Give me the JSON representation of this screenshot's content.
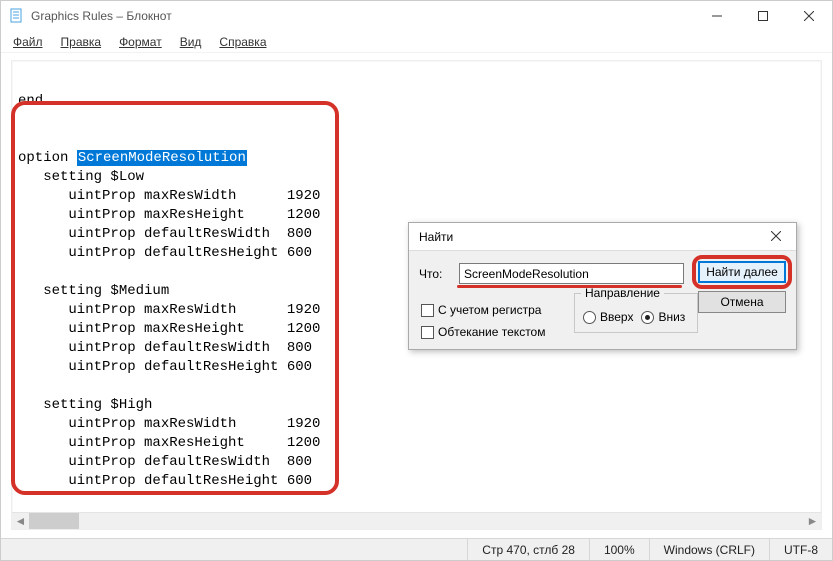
{
  "window": {
    "title": "Graphics Rules – Блокнот"
  },
  "menu": {
    "file": "Файл",
    "edit": "Правка",
    "format": "Формат",
    "view": "Вид",
    "help": "Справка"
  },
  "editor": {
    "l1": "end",
    "l2": "option ",
    "l2sel": "ScreenModeResolution",
    "l3": "   setting $Low",
    "l4": "      uintProp maxResWidth      1920",
    "l5": "      uintProp maxResHeight     1200",
    "l6": "      uintProp defaultResWidth  800",
    "l7": "      uintProp defaultResHeight 600",
    "l8": "   setting $Medium",
    "l9": "      uintProp maxResWidth      1920",
    "l10": "      uintProp maxResHeight     1200",
    "l11": "      uintProp defaultResWidth  800",
    "l12": "      uintProp defaultResHeight 600",
    "l13": "   setting $High",
    "l14": "      uintProp maxResWidth      1920",
    "l15": "      uintProp maxResHeight     1200",
    "l16": "      uintProp defaultResWidth  800",
    "l17": "      uintProp defaultResHeight 600"
  },
  "find": {
    "title": "Найти",
    "what_label": "Что:",
    "what_value": "ScreenModeResolution",
    "find_next": "Найти далее",
    "cancel": "Отмена",
    "direction": "Направление",
    "up": "Вверх",
    "down": "Вниз",
    "match_case": "С учетом регистра",
    "wrap": "Обтекание текстом"
  },
  "status": {
    "pos": "Стр 470, стлб 28",
    "zoom": "100%",
    "eol": "Windows (CRLF)",
    "enc": "UTF-8"
  }
}
